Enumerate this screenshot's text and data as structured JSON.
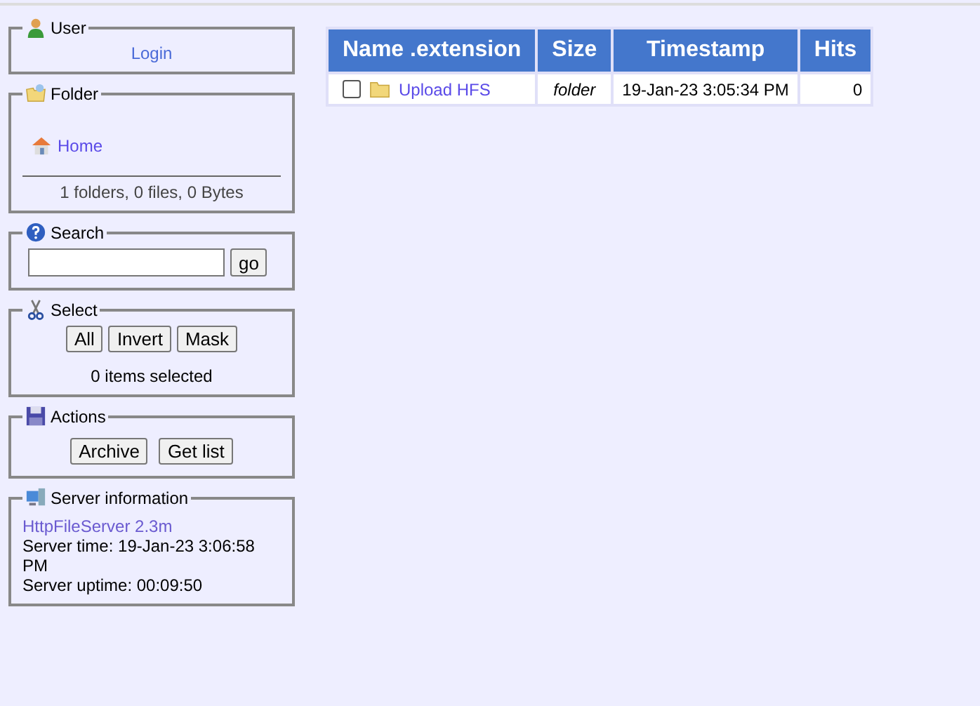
{
  "panels": [
    {
      "kind": "user",
      "title": "User",
      "login": "Login"
    },
    {
      "kind": "folder",
      "title": "Folder",
      "home": "Home",
      "summary": "1 folders, 0 files, 0 Bytes"
    },
    {
      "kind": "search",
      "title": "Search",
      "button": "go"
    },
    {
      "kind": "select",
      "title": "Select",
      "buttons": [
        "All",
        "Invert",
        "Mask"
      ],
      "status": "0 items selected"
    },
    {
      "kind": "actions",
      "title": "Actions",
      "buttons": [
        "Archive",
        "Get list"
      ]
    },
    {
      "kind": "server",
      "title": "Server information",
      "link": "HttpFileServer 2.3m",
      "lines": [
        "Server time: 19-Jan-23 3:06:58 PM",
        "Server uptime: 00:09:50"
      ]
    }
  ],
  "table": {
    "columns": [
      "Name .extension",
      "Size",
      "Timestamp",
      "Hits"
    ],
    "rows": [
      {
        "checked": false,
        "name": "Upload HFS",
        "size": "folder",
        "timestamp": "19-Jan-23 3:05:34 PM",
        "hits": "0"
      }
    ]
  }
}
